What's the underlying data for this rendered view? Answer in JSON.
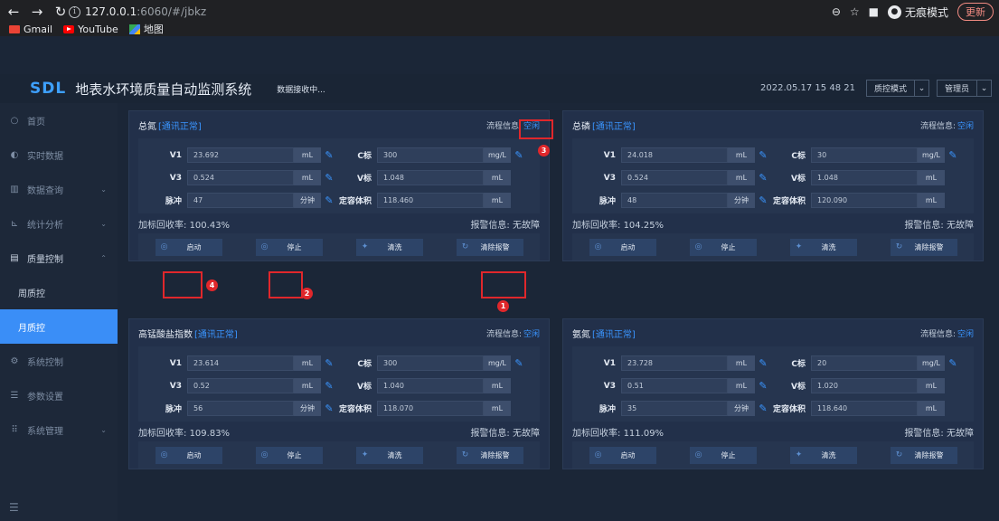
{
  "browser": {
    "url_host": "127.0.0.1",
    "url_rest": ":6060/#/jbkz",
    "incognito_label": "无痕模式",
    "update_label": "更新",
    "bookmarks": [
      "Gmail",
      "YouTube",
      "地图"
    ]
  },
  "header": {
    "logo": "SDL",
    "title": "地表水环境质量自动监测系统",
    "recv_status": "数据接收中...",
    "datetime": "2022.05.17  15  48  21",
    "mode_select": "质控模式",
    "user_select": "管理员"
  },
  "sidebar": {
    "items": [
      {
        "label": "首页",
        "icon": "home-icon",
        "glyph": "○"
      },
      {
        "label": "实时数据",
        "icon": "realtime-icon",
        "glyph": "◐"
      },
      {
        "label": "数据查询",
        "icon": "query-icon",
        "glyph": "▥",
        "caret": "⌄"
      },
      {
        "label": "统计分析",
        "icon": "stats-icon",
        "glyph": "⊾",
        "caret": "⌄"
      },
      {
        "label": "质量控制",
        "icon": "quality-icon",
        "glyph": "▤",
        "caret": "⌃"
      },
      {
        "label": "周质控"
      },
      {
        "label": "月质控"
      },
      {
        "label": "系统控制",
        "icon": "control-icon",
        "glyph": "⚙"
      },
      {
        "label": "参数设置",
        "icon": "params-icon",
        "glyph": "☰"
      },
      {
        "label": "系统管理",
        "icon": "admin-icon",
        "glyph": "⠿",
        "caret": "⌄"
      }
    ],
    "collapse_glyph": "☰"
  },
  "labels": {
    "flow": "流程信息:",
    "recovery_prefix": "加标回收率: ",
    "alarm": "报警信息: 无故障",
    "v1": "V1",
    "v3": "V3",
    "pulse": "脉冲",
    "c_std": "C标",
    "v_std": "V标",
    "fixed_vol": "定容体积",
    "unit_ml": "mL",
    "unit_mgl": "mg/L",
    "unit_pulse": "分钟",
    "btn_start": "启动",
    "btn_stop": "停止",
    "btn_clean": "清洗",
    "btn_clear_alarm": "清除报警"
  },
  "panels": [
    {
      "name": "总氮",
      "comm": "[通讯正常]",
      "flow": "空闲",
      "v1": "23.692",
      "c_std": "300",
      "v3": "0.524",
      "v_std": "1.048",
      "pulse": "47",
      "fixed_vol": "118.460",
      "recovery": "100.43%"
    },
    {
      "name": "总磷",
      "comm": "[通讯正常]",
      "flow": "空闲",
      "v1": "24.018",
      "c_std": "30",
      "v3": "0.524",
      "v_std": "1.048",
      "pulse": "48",
      "fixed_vol": "120.090",
      "recovery": "104.25%"
    },
    {
      "name": "高锰酸盐指数",
      "comm": "[通讯正常]",
      "flow": "空闲",
      "v1": "23.614",
      "c_std": "300",
      "v3": "0.52",
      "v_std": "1.040",
      "pulse": "56",
      "fixed_vol": "118.070",
      "recovery": "109.83%"
    },
    {
      "name": "氨氮",
      "comm": "[通讯正常]",
      "flow": "空闲",
      "v1": "23.728",
      "c_std": "20",
      "v3": "0.51",
      "v_std": "1.020",
      "pulse": "35",
      "fixed_vol": "118.640",
      "recovery": "111.09%"
    }
  ],
  "annotations": [
    "1",
    "2",
    "3",
    "4"
  ],
  "colors": {
    "accent": "#3a95ff",
    "annotation": "#e0272b",
    "active_nav": "#3a8ef7"
  }
}
